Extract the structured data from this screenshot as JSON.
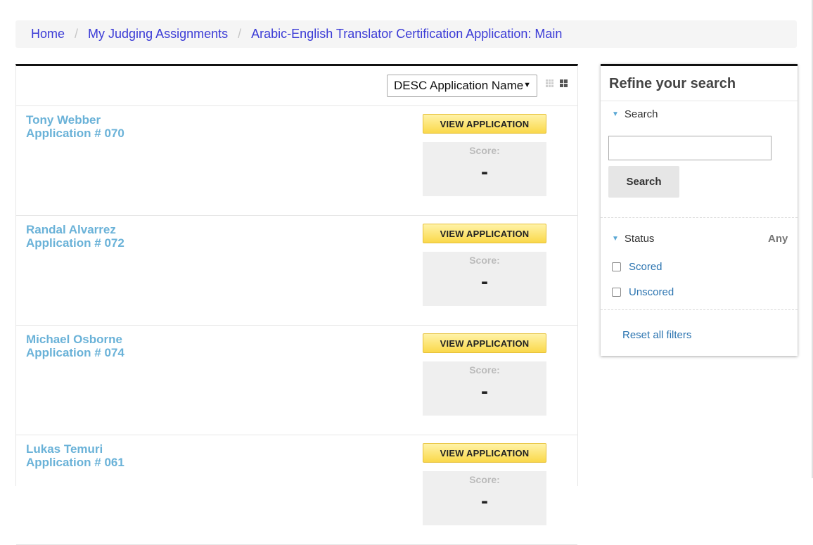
{
  "breadcrumb": {
    "items": [
      {
        "label": "Home"
      },
      {
        "label": "My Judging Assignments"
      },
      {
        "label": "Arabic-English Translator Certification Application: Main"
      }
    ],
    "separator": "/"
  },
  "toolbar": {
    "sort_value": "DESC Application Name",
    "sort_caret": "▼",
    "view_toggles": [
      "grid-small-icon",
      "grid-large-icon"
    ]
  },
  "applications": [
    {
      "name": "Tony Webber",
      "app_no": "Application # 070",
      "button": "VIEW APPLICATION",
      "score_label": "Score:",
      "score": "-"
    },
    {
      "name": "Randal Alvarrez",
      "app_no": "Application # 072",
      "button": "VIEW APPLICATION",
      "score_label": "Score:",
      "score": "-"
    },
    {
      "name": "Michael Osborne",
      "app_no": "Application # 074",
      "button": "VIEW APPLICATION",
      "score_label": "Score:",
      "score": "-"
    },
    {
      "name": "Lukas Temuri",
      "app_no": "Application # 061",
      "button": "VIEW APPLICATION",
      "score_label": "Score:",
      "score": "-"
    }
  ],
  "refine": {
    "title": "Refine your search",
    "search": {
      "heading": "Search",
      "value": "",
      "button": "Search"
    },
    "status": {
      "heading": "Status",
      "selected": "Any",
      "options": [
        {
          "label": "Scored",
          "checked": false
        },
        {
          "label": "Unscored",
          "checked": false
        }
      ]
    },
    "reset": "Reset all filters"
  },
  "colors": {
    "link": "#3b3bd6",
    "applicant": "#6ab2d8",
    "button_yellow": "#fad84a",
    "filter_link": "#2b74b0"
  }
}
